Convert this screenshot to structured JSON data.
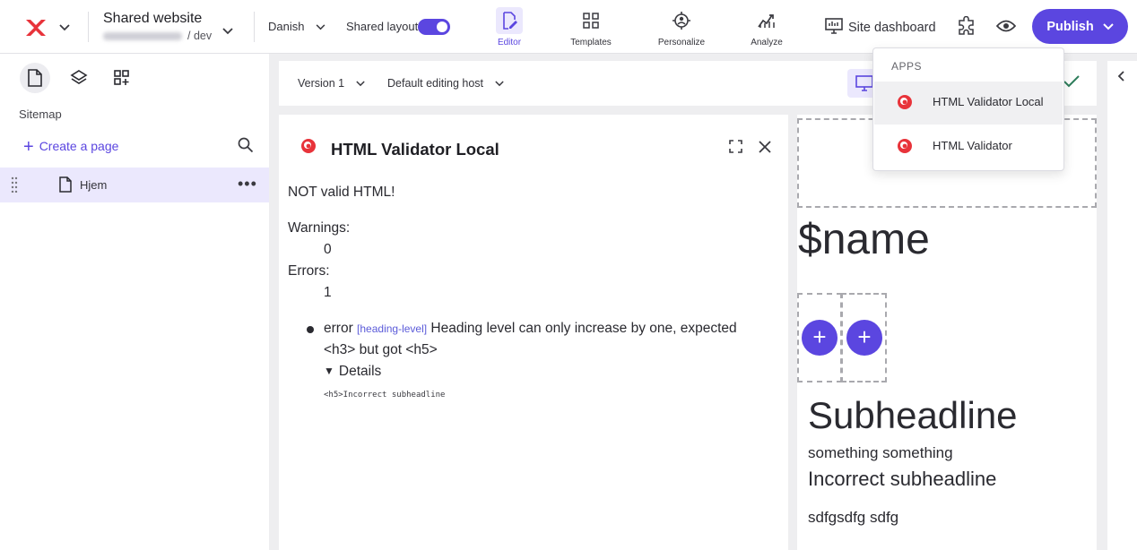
{
  "header": {
    "site_title": "Shared website",
    "site_env": "/ dev",
    "language": "Danish",
    "shared_layout_label": "Shared layout",
    "shared_layout_on": true,
    "nav": [
      {
        "label": "Editor",
        "icon": "edit-page-icon",
        "active": true
      },
      {
        "label": "Templates",
        "icon": "templates-icon",
        "active": false
      },
      {
        "label": "Personalize",
        "icon": "personalize-icon",
        "active": false
      },
      {
        "label": "Analyze",
        "icon": "analyze-icon",
        "active": false
      }
    ],
    "site_dashboard_label": "Site dashboard",
    "publish_label": "Publish"
  },
  "sidebar": {
    "section_label": "Sitemap",
    "create_label": "Create a page",
    "pages": [
      {
        "label": "Hjem"
      }
    ]
  },
  "toolbar": {
    "version": "Version 1",
    "host": "Default editing host"
  },
  "validator": {
    "title": "HTML Validator Local",
    "status": "NOT valid HTML!",
    "warnings_label": "Warnings:",
    "warnings_count": "0",
    "errors_label": "Errors:",
    "errors_count": "1",
    "error_type": "error",
    "error_rule": "[heading-level]",
    "error_message_line1": "Heading level can only increase by one, expected",
    "error_message_line2": "<h3> but got <h5>",
    "details_label": "Details",
    "details_code": "<h5>Incorrect subheadline"
  },
  "canvas": {
    "name_placeholder": "$name",
    "subheadline": "Subheadline",
    "tagline": "something something",
    "incorrect_subheadline": "Incorrect subheadline",
    "body_text": "sdfgsdfg sdfg"
  },
  "apps_dropdown": {
    "heading": "APPS",
    "items": [
      {
        "label": "HTML Validator Local",
        "highlighted": true
      },
      {
        "label": "HTML Validator",
        "highlighted": false
      }
    ]
  },
  "colors": {
    "accent": "#5b46e0",
    "accent_light": "#ebe8fd",
    "app_icon_red": "#e8333a"
  }
}
